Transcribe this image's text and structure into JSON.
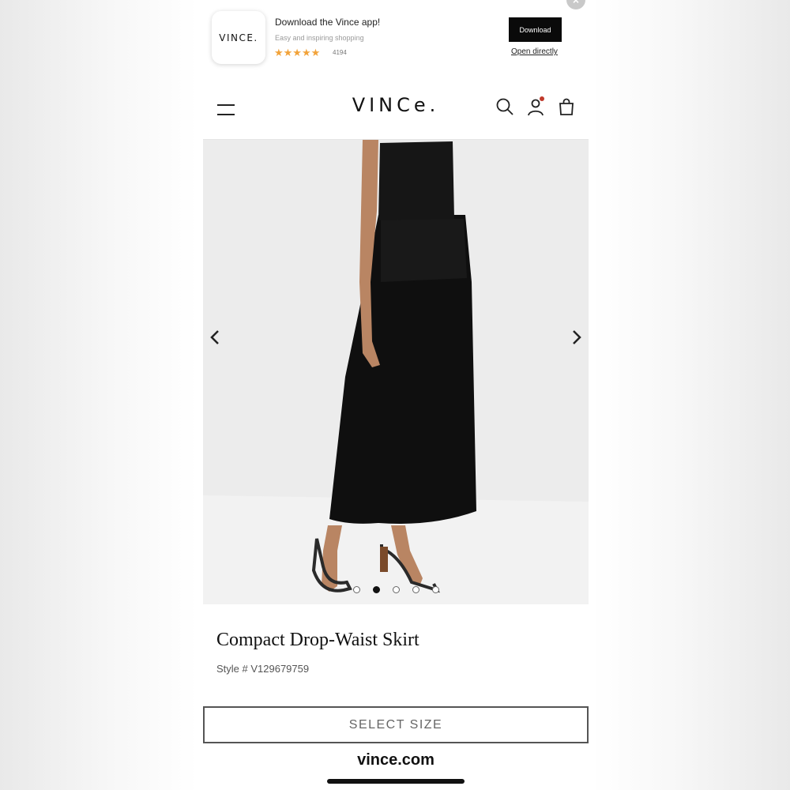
{
  "banner": {
    "app_icon_text": "VINCE.",
    "title": "Download the Vince app!",
    "subtitle": "Easy and inspiring shopping",
    "stars": "★★★★★",
    "rating_value": 4.5,
    "rating_count": "4194",
    "download_label": "Download",
    "open_label": "Open directly",
    "close_glyph": "×",
    "star_color": "#f2a33a"
  },
  "header": {
    "logo": "VINCe.",
    "icons": [
      "menu-icon",
      "search-icon",
      "account-icon",
      "shopping-bag-icon"
    ],
    "notification_color": "#c0392b"
  },
  "gallery": {
    "prev_icon": "chevron-left-icon",
    "next_icon": "chevron-right-icon",
    "dot_count": 5,
    "active_index": 1
  },
  "product": {
    "name": "Compact Drop-Waist Skirt",
    "style": "Style # V129679759",
    "select_size_label": "SELECT SIZE"
  },
  "browser": {
    "domain": "vince.com"
  }
}
